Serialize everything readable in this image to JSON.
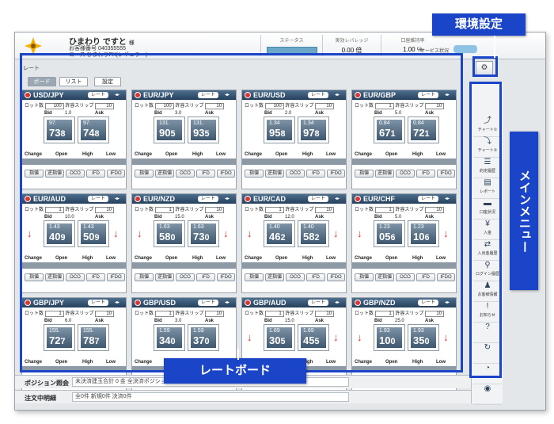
{
  "callouts": {
    "settings": "環境設定",
    "menu": "メインメニュー",
    "board": "レートボード"
  },
  "header": {
    "user_name": "ひまわり ですと",
    "honorific": "様",
    "account": "お客様番号 040355555",
    "course": "コース ひまわりFX(レギュラー)",
    "status_label": "ステータス",
    "leverage_label": "実効レバレッジ",
    "leverage_value": "0.00 倍",
    "margin_label": "口座維持率",
    "margin_value": "1.00 ℅",
    "service_label": "サービス状況"
  },
  "panel": {
    "title": "レート",
    "tabs": [
      "ボード",
      "リスト",
      "設定"
    ]
  },
  "card_labels": {
    "rate_btn": "レート",
    "lot": "ロット数",
    "slip": "許容スリップ",
    "bid": "Bid",
    "ask": "Ask",
    "change": "Change",
    "open": "Open",
    "high": "High",
    "low": "Low",
    "buttons": [
      "指値",
      "逆指値",
      "OCO",
      "IFD",
      "IFDO"
    ]
  },
  "cards": [
    {
      "pair": "USD/JPY",
      "lot": "100",
      "slip": "10",
      "spread": "1.0",
      "bid_big": "97.",
      "bid_lrg": "73",
      "bid_sm": "8",
      "ask_big": "97.",
      "ask_lrg": "74",
      "ask_sm": "8",
      "arrow": ""
    },
    {
      "pair": "EUR/JPY",
      "lot": "100",
      "slip": "10",
      "spread": "3.0",
      "bid_big": "131.",
      "bid_lrg": "90",
      "bid_sm": "5",
      "ask_big": "131.",
      "ask_lrg": "93",
      "ask_sm": "5",
      "arrow": ""
    },
    {
      "pair": "EUR/USD",
      "lot": "100",
      "slip": "10",
      "spread": "2.0",
      "bid_big": "1.34",
      "bid_lrg": "95",
      "bid_sm": "8",
      "ask_big": "1.34",
      "ask_lrg": "97",
      "ask_sm": "8",
      "arrow": ""
    },
    {
      "pair": "EUR/GBP",
      "lot": "1",
      "slip": "10",
      "spread": "5.0",
      "bid_big": "0.84",
      "bid_lrg": "67",
      "bid_sm": "1",
      "ask_big": "0.84",
      "ask_lrg": "72",
      "ask_sm": "1",
      "arrow": ""
    },
    {
      "pair": "EUR/AUD",
      "lot": "1",
      "slip": "10",
      "spread": "10.0",
      "bid_big": "1.43",
      "bid_lrg": "40",
      "bid_sm": "9",
      "ask_big": "1.43",
      "ask_lrg": "50",
      "ask_sm": "9",
      "arrow": "↓"
    },
    {
      "pair": "EUR/NZD",
      "lot": "1",
      "slip": "10",
      "spread": "15.0",
      "bid_big": "1.63",
      "bid_lrg": "58",
      "bid_sm": "0",
      "ask_big": "1.63",
      "ask_lrg": "73",
      "ask_sm": "0",
      "arrow": "↓"
    },
    {
      "pair": "EUR/CAD",
      "lot": "1",
      "slip": "10",
      "spread": "12.0",
      "bid_big": "1.40",
      "bid_lrg": "46",
      "bid_sm": "2",
      "ask_big": "1.40",
      "ask_lrg": "58",
      "ask_sm": "2",
      "arrow": "↓"
    },
    {
      "pair": "EUR/CHF",
      "lot": "1",
      "slip": "10",
      "spread": "5.0",
      "bid_big": "1.23",
      "bid_lrg": "05",
      "bid_sm": "6",
      "ask_big": "1.23",
      "ask_lrg": "10",
      "ask_sm": "6",
      "arrow": "↓"
    },
    {
      "pair": "GBP/JPY",
      "lot": "1",
      "slip": "10",
      "spread": "6.0",
      "bid_big": "155.",
      "bid_lrg": "72",
      "bid_sm": "7",
      "ask_big": "155.",
      "ask_lrg": "78",
      "ask_sm": "7",
      "arrow": ""
    },
    {
      "pair": "GBP/USD",
      "lot": "1",
      "slip": "10",
      "spread": "3.0",
      "bid_big": "1.59",
      "bid_lrg": "34",
      "bid_sm": "0",
      "ask_big": "1.59",
      "ask_lrg": "37",
      "ask_sm": "0",
      "arrow": ""
    },
    {
      "pair": "GBP/AUD",
      "lot": "1",
      "slip": "10",
      "spread": "15.0",
      "bid_big": "1.69",
      "bid_lrg": "30",
      "bid_sm": "5",
      "ask_big": "1.69",
      "ask_lrg": "45",
      "ask_sm": "5",
      "arrow": "↓"
    },
    {
      "pair": "GBP/NZD",
      "lot": "1",
      "slip": "10",
      "spread": "25.0",
      "bid_big": "1.93",
      "bid_lrg": "10",
      "bid_sm": "0",
      "ask_big": "1.93",
      "ask_lrg": "35",
      "ask_sm": "0",
      "arrow": "↓"
    }
  ],
  "bottom": {
    "position_label": "ポジション照会",
    "position_value": "未決済建玉合計 0 金 全決済ポジション",
    "order_label": "注文中明細",
    "order_value": "全0件 新規0件 決済0件"
  },
  "menu": [
    {
      "icon": "chart-up-icon",
      "label": "チャート①"
    },
    {
      "icon": "chart-down-icon",
      "label": "チャート②"
    },
    {
      "icon": "history-icon",
      "label": "約定履歴"
    },
    {
      "icon": "report-icon",
      "label": "レポート"
    },
    {
      "icon": "deposit-icon",
      "label": "口座状況"
    },
    {
      "icon": "money-icon",
      "label": "入金"
    },
    {
      "icon": "transfer-icon",
      "label": "入出金履歴"
    },
    {
      "icon": "login-icon",
      "label": "ログイン履歴"
    },
    {
      "icon": "user-icon",
      "label": "お客様情報"
    },
    {
      "icon": "notice-icon",
      "label": "お知らせ"
    },
    {
      "icon": "help-icon",
      "label": ""
    },
    {
      "icon": "refresh-icon",
      "label": ""
    },
    {
      "icon": "speed-icon",
      "label": ""
    },
    {
      "icon": "eye-icon",
      "label": ""
    }
  ],
  "colors": {
    "callout": "#1b45c8",
    "header_blue": "#25405c",
    "down_arrow": "#e12a2a"
  }
}
